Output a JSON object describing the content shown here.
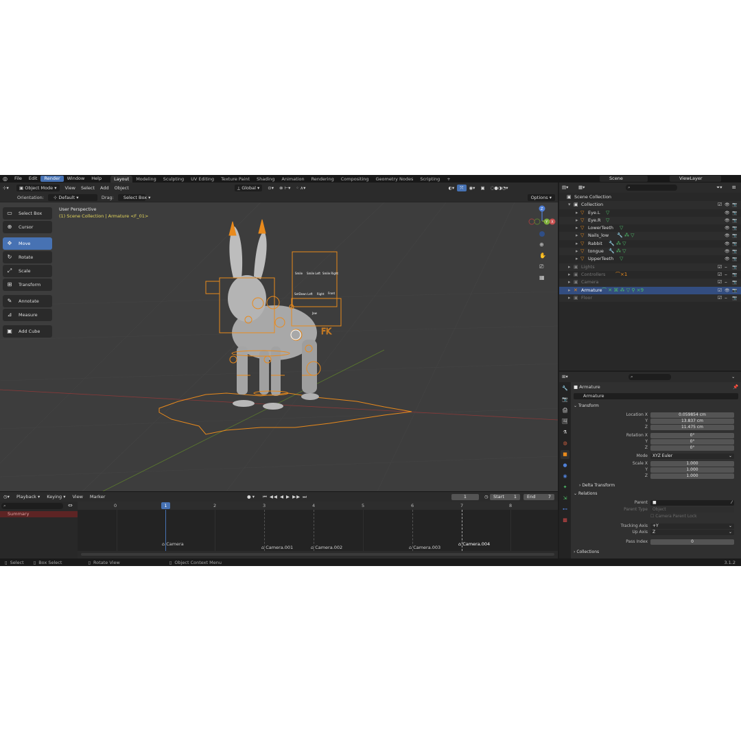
{
  "topbar": {
    "menus": [
      "File",
      "Edit",
      "Render",
      "Window",
      "Help"
    ],
    "active_menu": "Render",
    "workspaces": [
      "Layout",
      "Modeling",
      "Sculpting",
      "UV Editing",
      "Texture Paint",
      "Shading",
      "Animation",
      "Rendering",
      "Compositing",
      "Geometry Nodes",
      "Scripting"
    ],
    "add_workspace": "+",
    "scene": "Scene",
    "view_layer": "ViewLayer"
  },
  "viewport": {
    "mode": "Object Mode",
    "menus": [
      "View",
      "Select",
      "Add",
      "Object"
    ],
    "transform_orientation": "Global",
    "orientation_label": "Orientation:",
    "orientation_value": "Default",
    "drag_label": "Drag:",
    "drag_value": "Select Box",
    "options_label": "Options",
    "perspective": "User Perspective",
    "context_path": "(1) Scene Collection | Armature <F_01>",
    "gizmo": {
      "x": "X",
      "y": "Y",
      "z": "Z"
    },
    "rig_labels": [
      "Smile",
      "Smile Left",
      "Smile Right",
      "SetDown Left",
      "Right",
      "Front",
      "Jaw",
      "FK"
    ]
  },
  "tools": [
    {
      "label": "Select Box",
      "icon": "▭"
    },
    {
      "label": "Cursor",
      "icon": "⊕"
    },
    {
      "label": "Move",
      "icon": "✥"
    },
    {
      "label": "Rotate",
      "icon": "↻"
    },
    {
      "label": "Scale",
      "icon": "⤢"
    },
    {
      "label": "Transform",
      "icon": "⊞"
    },
    {
      "label": "Annotate",
      "icon": "✎"
    },
    {
      "label": "Measure",
      "icon": "📐"
    },
    {
      "label": "Add Cube",
      "icon": "▣"
    }
  ],
  "timeline": {
    "menus": [
      "Playback",
      "Keying",
      "View",
      "Marker"
    ],
    "current_frame": "1",
    "start_label": "Start",
    "start_value": "1",
    "end_label": "End",
    "end_value": "7",
    "summary": "Summary",
    "ticks": [
      "0",
      "1",
      "2",
      "3",
      "4",
      "5",
      "6",
      "7",
      "8"
    ],
    "markers": [
      {
        "label": "Camera",
        "frame": 1
      },
      {
        "label": "Camera.001",
        "frame": 3
      },
      {
        "label": "Camera.002",
        "frame": 4
      },
      {
        "label": "Camera.003",
        "frame": 6
      },
      {
        "label": "Camera.004",
        "frame": 7
      }
    ]
  },
  "status": {
    "select": "Select",
    "box_select": "Box Select",
    "rotate_view": "Rotate View",
    "context_menu": "Object Context Menu",
    "version": "3.1.2"
  },
  "outliner": {
    "rows": [
      {
        "name": "Scene Collection",
        "depth": 0,
        "type": "scene"
      },
      {
        "name": "Collection",
        "depth": 1,
        "type": "collection"
      },
      {
        "name": "Eye.L",
        "depth": 2,
        "type": "mesh"
      },
      {
        "name": "Eye.R",
        "depth": 2,
        "type": "mesh"
      },
      {
        "name": "LowerTeeth",
        "depth": 2,
        "type": "mesh"
      },
      {
        "name": "Nails_low",
        "depth": 2,
        "type": "mesh"
      },
      {
        "name": "Rabbit",
        "depth": 2,
        "type": "mesh"
      },
      {
        "name": "tongue",
        "depth": 2,
        "type": "mesh"
      },
      {
        "name": "UpperTeeth",
        "depth": 2,
        "type": "mesh"
      },
      {
        "name": "Lights",
        "depth": 1,
        "type": "collection-dim"
      },
      {
        "name": "Controllers",
        "depth": 1,
        "type": "collection-dim"
      },
      {
        "name": "Camera",
        "depth": 1,
        "type": "collection-dim"
      },
      {
        "name": "Armature",
        "depth": 1,
        "type": "armature-selected"
      },
      {
        "name": "Floor",
        "depth": 1,
        "type": "collection-dim"
      }
    ],
    "armature_badge": "×9",
    "controllers_badge": "×1"
  },
  "properties": {
    "object_name": "Armature",
    "object_field": "Armature",
    "transform_panel": "Transform",
    "location_label": "Location X",
    "location": [
      "0.059854 cm",
      "13.837 cm",
      "11.475 cm"
    ],
    "rotation_label": "Rotation X",
    "rotation": [
      "0°",
      "0°",
      "0°"
    ],
    "mode_label": "Mode",
    "mode_value": "XYZ Euler",
    "scale_label": "Scale X",
    "scale": [
      "1.000",
      "1.000",
      "1.000"
    ],
    "axis_y": "Y",
    "axis_z": "Z",
    "delta_panel": "Delta Transform",
    "relations_panel": "Relations",
    "parent_label": "Parent",
    "parent_type_label": "Parent Type",
    "parent_type_value": "Object",
    "camera_parent_lock": "Camera Parent Lock",
    "tracking_axis_label": "Tracking Axis",
    "tracking_axis_value": "+Y",
    "up_axis_label": "Up Axis",
    "up_axis_value": "Z",
    "pass_index_label": "Pass Index",
    "pass_index_value": "0",
    "collections_panel": "Collections"
  },
  "colors": {
    "accent": "#4772b3",
    "rig_orange": "#e98a1c",
    "mesh_icon": "#5ec0a0",
    "mesh_green": "#4fc06a"
  }
}
